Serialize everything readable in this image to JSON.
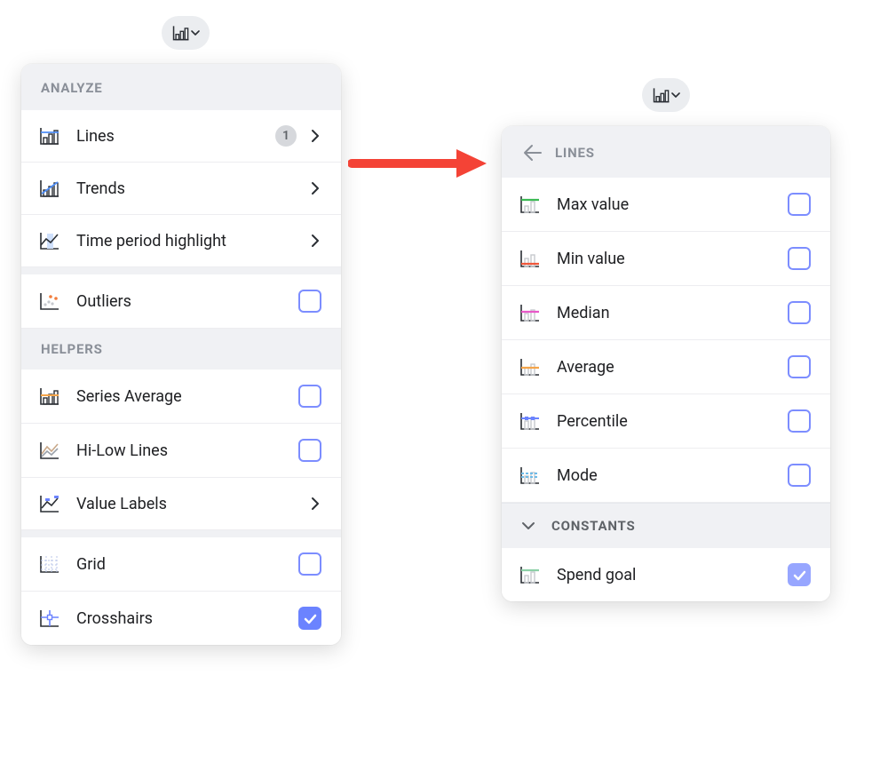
{
  "left": {
    "sections": {
      "analyze": {
        "title": "ANALYZE",
        "items": {
          "lines": {
            "label": "Lines",
            "badge": "1"
          },
          "trends": {
            "label": "Trends"
          },
          "tph": {
            "label": "Time period highlight"
          },
          "outliers": {
            "label": "Outliers"
          }
        }
      },
      "helpers": {
        "title": "HELPERS",
        "items": {
          "seriesavg": {
            "label": "Series Average"
          },
          "hilow": {
            "label": "Hi-Low Lines"
          },
          "valuelabels": {
            "label": "Value Labels"
          },
          "grid": {
            "label": "Grid"
          },
          "crosshairs": {
            "label": "Crosshairs"
          }
        }
      }
    }
  },
  "right": {
    "title": "LINES",
    "items": {
      "max": {
        "label": "Max value"
      },
      "min": {
        "label": "Min value"
      },
      "median": {
        "label": "Median"
      },
      "average": {
        "label": "Average"
      },
      "percentile": {
        "label": "Percentile"
      },
      "mode": {
        "label": "Mode"
      }
    },
    "constants": {
      "title": "CONSTANTS",
      "items": {
        "spendgoal": {
          "label": "Spend goal"
        }
      }
    }
  }
}
